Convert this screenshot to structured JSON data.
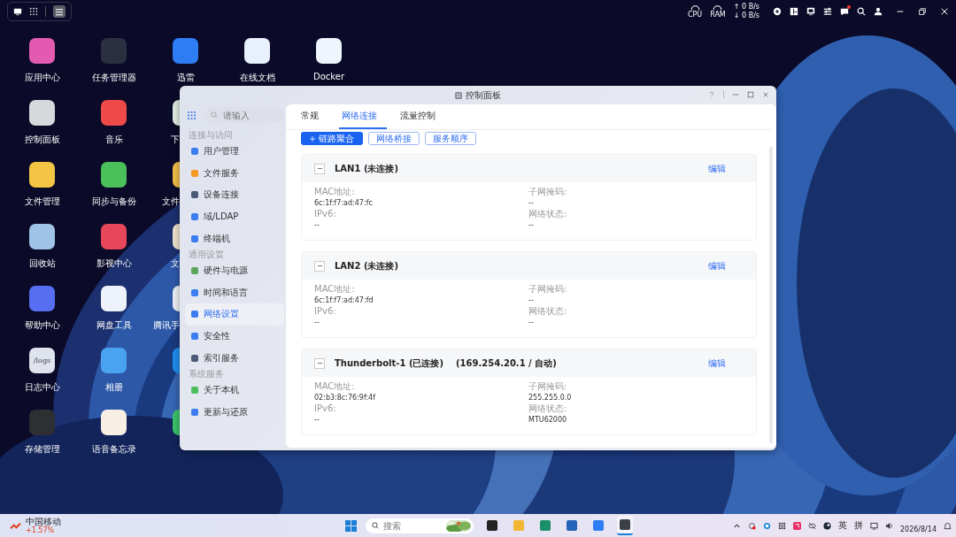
{
  "top_bar": {
    "cpu_label": "CPU",
    "ram_label": "RAM",
    "upload": "↑ 0 B/s",
    "download": "↓ 0 B/s",
    "notification": true
  },
  "desktop": {
    "columns": [
      [
        {
          "label": "应用中心",
          "color": "#e35bb0"
        },
        {
          "label": "控制面板",
          "color": "#d6d8dc"
        },
        {
          "label": "文件管理",
          "color": "#f4c545"
        },
        {
          "label": "回收站",
          "color": "#9fc3e6"
        },
        {
          "label": "帮助中心",
          "color": "#566ff2"
        },
        {
          "label": "日志中心",
          "color": "#dfe3ee",
          "icon_text": "/logs"
        },
        {
          "label": "存储管理",
          "color": "#2e2f33"
        }
      ],
      [
        {
          "label": "任务管理器",
          "color": "#2a3040"
        },
        {
          "label": "音乐",
          "color": "#ee4a4a"
        },
        {
          "label": "同步与备份",
          "color": "#4bbf5a"
        },
        {
          "label": "影视中心",
          "color": "#e6475b"
        },
        {
          "label": "网盘工具",
          "color": "#eef2fa"
        },
        {
          "label": "相册",
          "color": "#4aa3f0"
        },
        {
          "label": "语音备忘录",
          "color": "#f7efe4"
        }
      ],
      [
        {
          "label": "迅雷",
          "color": "#2f7df5"
        },
        {
          "label": "下",
          "color": "#e3eee3"
        },
        {
          "label": "文件",
          "color": "#f2c04a"
        },
        {
          "label": "文",
          "color": "#efe4cc"
        },
        {
          "label": "腾讯手",
          "color": "#eef2f8"
        },
        {
          "color": "#1e8ef0"
        },
        {
          "color": "#3cc36b"
        }
      ],
      [
        {
          "label": "在线文档",
          "color": "#e8f0fc"
        }
      ],
      [
        {
          "label": "Docker",
          "color": "#eef5fd"
        }
      ]
    ]
  },
  "window": {
    "title": "控制面板",
    "sidebar": {
      "search": {
        "placeholder": "请输入"
      },
      "groups": [
        {
          "title": "连接与访问",
          "items": [
            {
              "label": "用户管理",
              "selected": false,
              "color": "#3b7cf0"
            },
            {
              "label": "文件服务",
              "selected": false,
              "color": "#f59a23"
            },
            {
              "label": "设备连接",
              "selected": false,
              "color": "#4a5a78"
            },
            {
              "label": "域/LDAP",
              "selected": false,
              "color": "#3b7cf0"
            },
            {
              "label": "终端机",
              "selected": false,
              "color": "#3b7cf0"
            }
          ]
        },
        {
          "title": "通用设置",
          "items": [
            {
              "label": "硬件与电源",
              "selected": false,
              "color": "#5aa55a"
            },
            {
              "label": "时间和语言",
              "selected": false,
              "color": "#3b7cf0"
            },
            {
              "label": "网络设置",
              "selected": true,
              "color": "#3b7cf0"
            },
            {
              "label": "安全性",
              "selected": false,
              "color": "#3b7cf0"
            },
            {
              "label": "索引服务",
              "selected": false,
              "color": "#4a5a78"
            }
          ]
        },
        {
          "title": "系统服务",
          "items": [
            {
              "label": "关于本机",
              "selected": false,
              "color": "#4cbf5c"
            },
            {
              "label": "更新与还原",
              "selected": false,
              "color": "#3b7cf0"
            }
          ]
        }
      ]
    },
    "tabs": [
      {
        "label": "常规",
        "selected": false
      },
      {
        "label": "网络连接",
        "selected": true
      },
      {
        "label": "流量控制",
        "selected": false
      }
    ],
    "actions": [
      {
        "label": "链路聚合",
        "kind": "primary"
      },
      {
        "label": "网络桥接",
        "kind": "outline"
      },
      {
        "label": "服务顺序",
        "kind": "outline"
      }
    ],
    "connections": [
      {
        "name": "LAN1 (未连接)",
        "action": "编辑",
        "expanded": true,
        "left": [
          {
            "label": "MAC地址:",
            "value": "6c:1f:f7:ad:47:fc"
          },
          {
            "label": "IPv6:",
            "value": "--"
          }
        ],
        "right": [
          {
            "label": "子网掩码:",
            "value": "--"
          },
          {
            "label": "网络状态:",
            "value": "--"
          }
        ]
      },
      {
        "name": "LAN2 (未连接)",
        "action": "编辑",
        "expanded": true,
        "left": [
          {
            "label": "MAC地址:",
            "value": "6c:1f:f7:ad:47:fd"
          },
          {
            "label": "IPv6:",
            "value": "--"
          }
        ],
        "right": [
          {
            "label": "子网掩码:",
            "value": "--"
          },
          {
            "label": "网络状态:",
            "value": "--"
          }
        ]
      },
      {
        "name": "Thunderbolt-1 (已连接)",
        "address": "(169.254.20.1 / 自动)",
        "action": "编辑",
        "expanded": true,
        "left": [
          {
            "label": "MAC地址:",
            "value": "02:b3:8c:76:9f:4f"
          },
          {
            "label": "IPv6:",
            "value": "--"
          }
        ],
        "right": [
          {
            "label": "子网掩码:",
            "value": "255.255.0.0"
          },
          {
            "label": "网络状态:",
            "value": "MTU62000"
          }
        ]
      }
    ]
  },
  "taskbar": {
    "stock": {
      "name": "中国移动",
      "change": "+1.57%"
    },
    "search": {
      "placeholder": "搜索"
    },
    "apps": [
      {
        "color": "#222222",
        "selected": false
      },
      {
        "color": "#f2b632",
        "selected": false
      },
      {
        "color": "#1a8f6a",
        "selected": false
      },
      {
        "color": "#2563b8",
        "selected": false
      },
      {
        "color": "#2f7df5",
        "selected": false
      },
      {
        "color": "#3a3f48",
        "selected": true
      }
    ],
    "ime": [
      "英",
      "拼"
    ],
    "date": "2026/8/14"
  }
}
